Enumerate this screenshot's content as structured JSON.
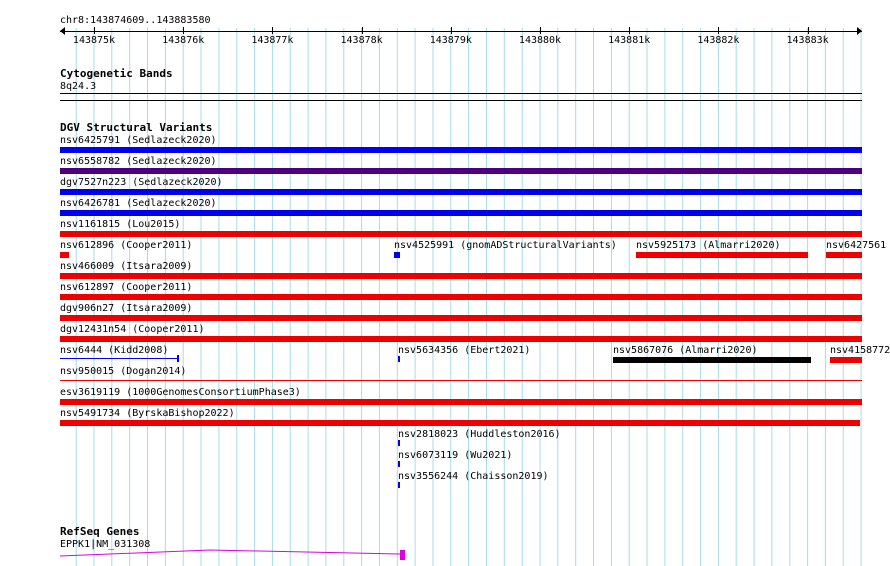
{
  "ruler": {
    "location": "chr8:143874609..143883580",
    "ticks": [
      "143875k",
      "143876k",
      "143877k",
      "143878k",
      "143879k",
      "143880k",
      "143881k",
      "143882k",
      "143883k"
    ]
  },
  "cytobands": {
    "title": "Cytogenetic Bands",
    "band": "8q24.3"
  },
  "dgv": {
    "title": "DGV Structural Variants",
    "features": [
      {
        "label": "nsv6425791 (Sedlazeck2020)",
        "color": "#0000ee"
      },
      {
        "label": "nsv6558782 (Sedlazeck2020)",
        "color": "#4b0082"
      },
      {
        "label": "dgv7527n223 (Sedlazeck2020)",
        "color": "#0000ee"
      },
      {
        "label": "nsv6426781 (Sedlazeck2020)",
        "color": "#0000ee"
      },
      {
        "label": "nsv1161815 (Lou2015)",
        "color": "#ee0000"
      },
      {
        "label": "nsv612896 (Cooper2011)",
        "color": "#ee0000"
      },
      {
        "label": "nsv4525991 (gnomADStructuralVariants)",
        "color": "#0000ee"
      },
      {
        "label": "nsv5925173 (Almarri2020)",
        "color": "#ee0000"
      },
      {
        "label": "nsv6427561",
        "color": "#ee0000"
      },
      {
        "label": "nsv466009 (Itsara2009)",
        "color": "#ee0000"
      },
      {
        "label": "nsv612897 (Cooper2011)",
        "color": "#ee0000"
      },
      {
        "label": "dgv906n27 (Itsara2009)",
        "color": "#ee0000"
      },
      {
        "label": "dgv12431n54 (Cooper2011)",
        "color": "#ee0000"
      },
      {
        "label": "nsv6444 (Kidd2008)",
        "color": "#0000ee"
      },
      {
        "label": "nsv5634356 (Ebert2021)",
        "color": "#0000ee"
      },
      {
        "label": "nsv5867076 (Almarri2020)",
        "color": "#000000"
      },
      {
        "label": "nsv4158772",
        "color": "#ee0000"
      },
      {
        "label": "nsv950015 (Dogan2014)",
        "color": "#ee0000"
      },
      {
        "label": "esv3619119 (1000GenomesConsortiumPhase3)",
        "color": "#ee0000"
      },
      {
        "label": "nsv5491734 (ByrskaBishop2022)",
        "color": "#ee0000"
      },
      {
        "label": "nsv2818023 (Huddleston2016)",
        "color": "#0000ee"
      },
      {
        "label": "nsv6073119 (Wu2021)",
        "color": "#0000ee"
      },
      {
        "label": "nsv3556244 (Chaisson2019)",
        "color": "#0000ee"
      }
    ]
  },
  "refseq": {
    "title": "RefSeq Genes",
    "gene": "EPPK1|NM_031308",
    "color": "#dd00dd"
  },
  "colors": {
    "grid": "#a8dce8",
    "ruler": "#000000"
  }
}
